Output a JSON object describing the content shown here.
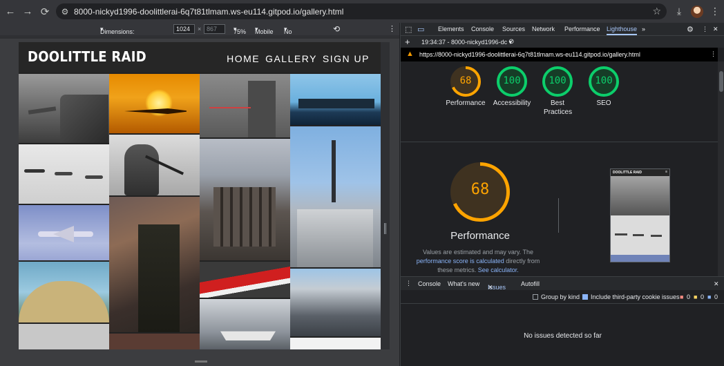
{
  "browser": {
    "url": "8000-nickyd1996-doolittlerai-6q7t81tlmam.ws-eu114.gitpod.io/gallery.html"
  },
  "device_toolbar": {
    "dimensions_label": "Dimensions: Responsive",
    "width": "1024",
    "height_placeholder": "867",
    "zoom": "75%",
    "device_type": "Mobile",
    "throttling": "No throttling"
  },
  "site": {
    "logo": "DOOLITTLE RAID",
    "nav": [
      "HOME",
      "GALLERY",
      "SIGN UP"
    ]
  },
  "devtools": {
    "tabs": [
      "Elements",
      "Console",
      "Sources",
      "Network",
      "Performance",
      "Lighthouse"
    ],
    "active_tab": "Lighthouse",
    "report_time": "19:34:37 - 8000-nickyd1996-dc",
    "report_url": "https://8000-nickyd1996-doolittlerai-6q7t81tlmam.ws-eu114.gitpod.io/gallery.html",
    "scores": [
      {
        "label": "Performance",
        "value": "68",
        "color": "#ffa400"
      },
      {
        "label": "Accessibility",
        "value": "100",
        "color": "#0cce6b"
      },
      {
        "label": "Best Practices",
        "value": "100",
        "color": "#0cce6b"
      },
      {
        "label": "SEO",
        "value": "100",
        "color": "#0cce6b"
      }
    ],
    "big_score": {
      "value": "68",
      "label": "Performance",
      "color": "#ffa400"
    },
    "description_pre": "Values are estimated and may vary. The ",
    "link1": "performance score is calculated",
    "description_mid": " directly from these metrics. ",
    "link2": "See calculator.",
    "thumb_logo": "DOOLITTLE RAID",
    "drawer_tabs": [
      "Console",
      "What's new",
      "Issues",
      "Autofill"
    ],
    "active_drawer_tab": "Issues",
    "group_by_kind": "Group by kind",
    "third_party": "Include third-party cookie issues",
    "counts": [
      "0",
      "0",
      "0"
    ],
    "no_issues": "No issues detected so far"
  },
  "colors": {
    "accent_blue": "#a8c7fa",
    "score_orange": "#ffa400",
    "score_green": "#0cce6b"
  }
}
